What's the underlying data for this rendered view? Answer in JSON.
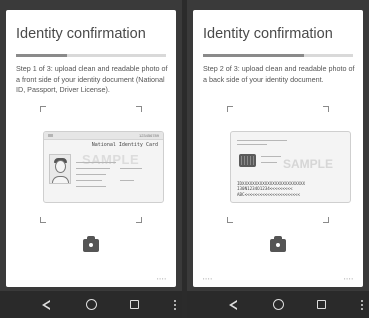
{
  "screens": [
    {
      "title": "Identity confirmation",
      "progress_fraction": 0.34,
      "step_text": "Step 1 of 3: upload clean and readable photo of a front side of your identity document (National ID, Passport, Driver License).",
      "card_number": "123456789",
      "card_title": "National Identity Card",
      "watermark": "SAMPLE",
      "icons": [
        "camera-icon"
      ]
    },
    {
      "title": "Identity confirmation",
      "progress_fraction": 0.67,
      "step_text": "Step 2 of 3: upload clean and readable photo of a back side of your identity document.",
      "watermark": "SAMPLE",
      "mrz": "IDXXXXXXXXXXXXXXXXXXXXXXXXX\nI30N1234O1234<<<<<<<<<\nABC<<<<<<<<<<<<<<<<<<<<<<",
      "icons": [
        "camera-icon"
      ]
    }
  ],
  "navbar": {
    "icons": [
      "back-icon",
      "home-icon",
      "recents-icon",
      "menu-icon"
    ]
  },
  "colors": {
    "background": "#2b2b2b",
    "card": "#ffffff",
    "progress_track": "#d9d9d9",
    "progress_fill": "#8a8a8a"
  }
}
